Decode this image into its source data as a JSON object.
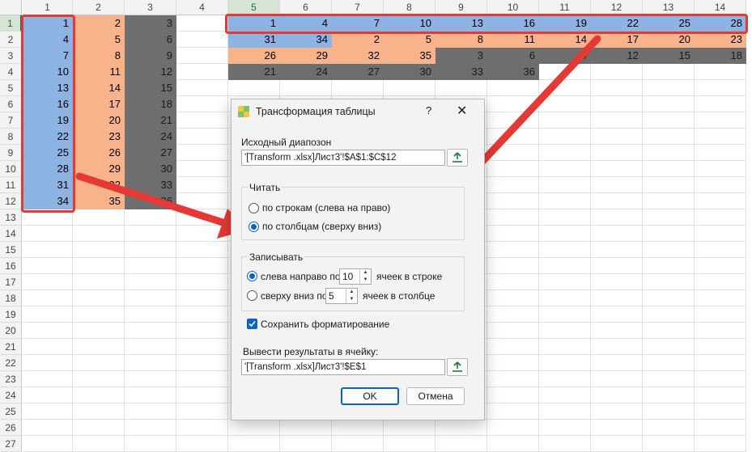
{
  "spreadsheet": {
    "column_headers": [
      "1",
      "2",
      "3",
      "4",
      "5",
      "6",
      "7",
      "8",
      "9",
      "10",
      "11",
      "12",
      "13",
      "14"
    ],
    "row_headers": [
      "1",
      "2",
      "3",
      "4",
      "5",
      "6",
      "7",
      "8",
      "9",
      "10",
      "11",
      "12",
      "13",
      "14",
      "15",
      "16",
      "17",
      "18",
      "19",
      "20",
      "21",
      "22",
      "23",
      "24",
      "25",
      "26",
      "27"
    ],
    "selected_column": "5",
    "selected_row": "1",
    "source_rows": [
      [
        "1",
        "2",
        "3"
      ],
      [
        "4",
        "5",
        "6"
      ],
      [
        "7",
        "8",
        "9"
      ],
      [
        "10",
        "11",
        "12"
      ],
      [
        "13",
        "14",
        "15"
      ],
      [
        "16",
        "17",
        "18"
      ],
      [
        "19",
        "20",
        "21"
      ],
      [
        "22",
        "23",
        "24"
      ],
      [
        "25",
        "26",
        "27"
      ],
      [
        "28",
        "29",
        "30"
      ],
      [
        "31",
        "32",
        "33"
      ],
      [
        "34",
        "35",
        "36"
      ]
    ],
    "result_rows": [
      [
        "1",
        "4",
        "7",
        "10",
        "13",
        "16",
        "19",
        "22",
        "25",
        "28"
      ],
      [
        "31",
        "34",
        "2",
        "5",
        "8",
        "11",
        "14",
        "17",
        "20",
        "23"
      ],
      [
        "26",
        "29",
        "32",
        "35",
        "3",
        "6",
        "9",
        "12",
        "15",
        "18"
      ],
      [
        "21",
        "24",
        "27",
        "30",
        "33",
        "36",
        "",
        "",
        "",
        ""
      ]
    ],
    "colors": {
      "blue": "#8db3e2",
      "orange": "#f8b38a",
      "gray": "#6e6e6e",
      "highlight": "#e53935"
    }
  },
  "dialog": {
    "title": "Трансформация таблицы",
    "help": "?",
    "close": "✕",
    "source_label": "Исходный диапозон",
    "source_value": "'[Transform .xlsx]Лист3'!$A$1:$C$12",
    "read_group": "Читать",
    "read_by_rows": "по строкам (слева на право)",
    "read_by_columns": "по столбцам (сверху вниз)",
    "read_selected": "columns",
    "write_group": "Записывать",
    "write_lr_prefix": "слева направо по",
    "write_lr_value": "10",
    "write_lr_suffix": "ячеек в строке",
    "write_tb_prefix": "сверху вниз по",
    "write_tb_value": "5",
    "write_tb_suffix": "ячеек в столбце",
    "write_selected": "left-to-right",
    "keep_format_label": "Сохранить форматирование",
    "keep_format_checked": true,
    "output_label": "Вывести результаты в ячейку:",
    "output_value": "'[Transform .xlsx]Лист3'!$E$1",
    "ok_label": "OK",
    "cancel_label": "Отмена"
  }
}
